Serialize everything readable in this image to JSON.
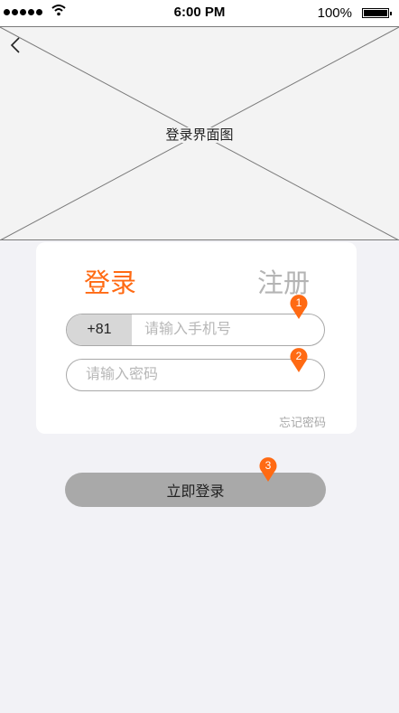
{
  "status_bar": {
    "time": "6:00 PM",
    "battery_percent": "100%",
    "signal_icon": "signal-dots-icon",
    "wifi_icon": "wifi-icon",
    "battery_icon": "battery-icon"
  },
  "hero": {
    "placeholder_label": "登录界面图",
    "back_icon": "chevron-left-icon"
  },
  "tabs": {
    "login_label": "登录",
    "register_label": "注册",
    "active": "login",
    "active_color": "#ff6a13",
    "inactive_color": "#b4b4b4"
  },
  "form": {
    "country_code": "+81",
    "phone_placeholder": "请输入手机号",
    "phone_value": "",
    "password_placeholder": "请输入密码",
    "password_value": "",
    "forgot_label": "忘记密码"
  },
  "submit": {
    "label": "立即登录",
    "color": "#a9a9a9"
  },
  "annotations": {
    "marker_color": "#ff6a13",
    "markers": [
      "1",
      "2",
      "3"
    ]
  }
}
